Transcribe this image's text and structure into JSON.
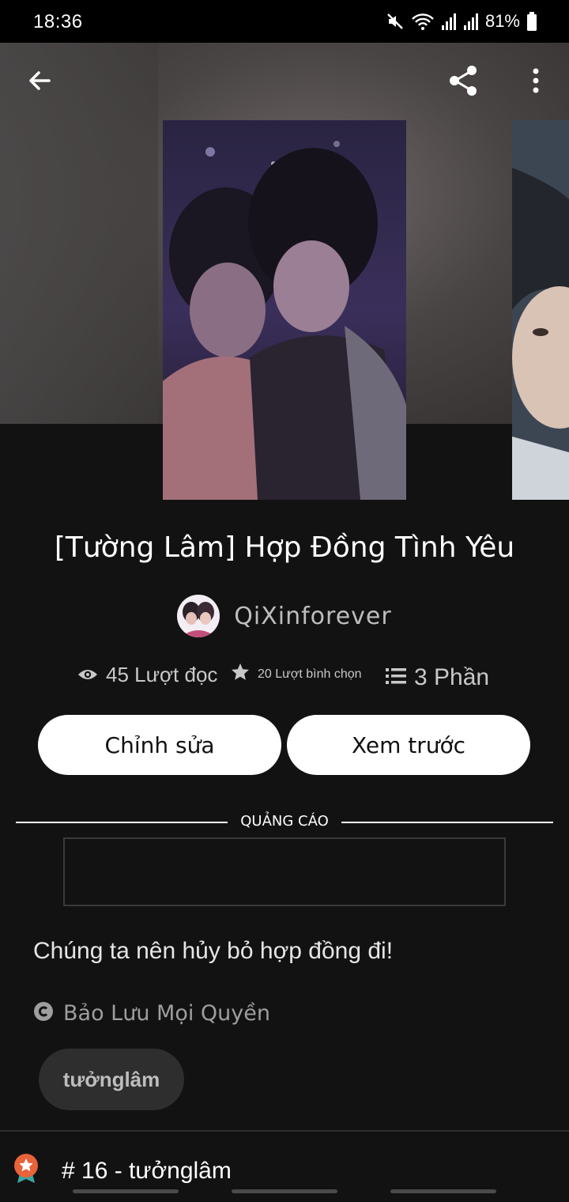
{
  "status_bar": {
    "time": "18:36",
    "battery": "81%",
    "icons": [
      "mute-icon",
      "wifi-icon",
      "signal-icon",
      "signal-icon",
      "battery-icon"
    ]
  },
  "header": {
    "back_icon": "arrow-left-icon",
    "share_icon": "share-icon",
    "more_icon": "more-vertical-icon"
  },
  "story": {
    "title": "[Tường Lâm] Hợp Đồng Tình Yêu",
    "author": "QiXinforever",
    "stats": {
      "reads": "45 Lượt đọc",
      "votes": "20 Lượt bình chọn",
      "parts": "3 Phần"
    },
    "description": "Chúng ta nên hủy bỏ hợp đồng đi!",
    "copyright": "Bảo Lưu Mọi Quyền",
    "tag": "tưởnglâm",
    "rank": "# 16 - tưởnglâm"
  },
  "actions": {
    "edit_label": "Chỉnh sửa",
    "preview_label": "Xem trước"
  },
  "ad": {
    "label": "QUẢNG CÁO"
  },
  "colors": {
    "background": "#121212",
    "button_bg": "#ffffff",
    "chip_bg": "#2e2e2e",
    "rank_badge": "#e8623a"
  }
}
